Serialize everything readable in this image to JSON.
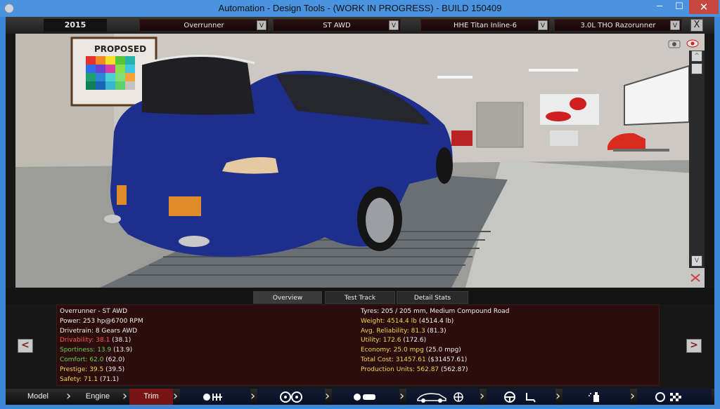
{
  "window": {
    "title": "Automation - Design Tools - (WORK IN PROGRESS) - BUILD 150409",
    "minimize": "─",
    "maximize": "☐",
    "close": "✕"
  },
  "topbar": {
    "year": "2015",
    "model": "Overrunner",
    "trim": "ST AWD",
    "engine_family": "HHE Titan Inline-6",
    "engine": "3.0L THO  Razorunner",
    "dropdown_arrow": "V",
    "close": "X"
  },
  "viewport": {
    "poster_text": "PROPOSED",
    "scroll_up": "^",
    "scroll_down": "V"
  },
  "tabs": [
    {
      "label": "Overview",
      "active": true
    },
    {
      "label": "Test Track",
      "active": false
    },
    {
      "label": "Detail Stats",
      "active": false
    }
  ],
  "stats": {
    "left": [
      {
        "text": "Overrunner - ST AWD",
        "tone": "white"
      },
      {
        "text": "Power: 253 hp@6700 RPM",
        "tone": "white"
      },
      {
        "text": "Drivetrain: 8 Gears AWD",
        "tone": "white"
      },
      {
        "label": "Drivability:",
        "value": "38.1",
        "ref": "(38.1)",
        "tone": "red"
      },
      {
        "label": "Sportiness:",
        "value": "13.9",
        "ref": "(13.9)",
        "tone": "green"
      },
      {
        "label": "Comfort:",
        "value": "62.0",
        "ref": "(62.0)",
        "tone": "green"
      },
      {
        "label": "Prestige:",
        "value": "39.5",
        "ref": "(39.5)",
        "tone": "yellow"
      },
      {
        "label": "Safety:",
        "value": "71.1",
        "ref": "(71.1)",
        "tone": "yellow"
      }
    ],
    "right": [
      {
        "text": "Tyres: 205 / 205 mm, Medium Compound Road",
        "tone": "white"
      },
      {
        "label": "Weight:",
        "value": "4514.4 lb",
        "ref": "(4514.4 lb)",
        "tone": "yellow"
      },
      {
        "label": "Avg. Reliability:",
        "value": "81.3",
        "ref": "(81.3)",
        "tone": "yellow"
      },
      {
        "label": "Utility:",
        "value": "172.6",
        "ref": "(172.6)",
        "tone": "yellow"
      },
      {
        "label": "Economy:",
        "value": "25.0 mpg",
        "ref": "(25.0 mpg)",
        "tone": "yellow"
      },
      {
        "label": "Total Cost:",
        "value": "31457.61",
        "ref": "($31457.61)",
        "tone": "yellow"
      },
      {
        "label": "Production Units:",
        "value": "562.87",
        "ref": "(562.87)",
        "tone": "yellow"
      }
    ]
  },
  "nav": {
    "prev": "<",
    "next": ">"
  },
  "bottom_nav": {
    "model": "Model",
    "engine": "Engine",
    "trim": "Trim",
    "chevron": "›",
    "icons": [
      "chassis-icon",
      "wheels-icon",
      "engine-bay-icon",
      "car-body-icon",
      "fan-icon",
      "steering-icon",
      "seat-icon",
      "spray-icon",
      "test-flag-icon"
    ]
  }
}
